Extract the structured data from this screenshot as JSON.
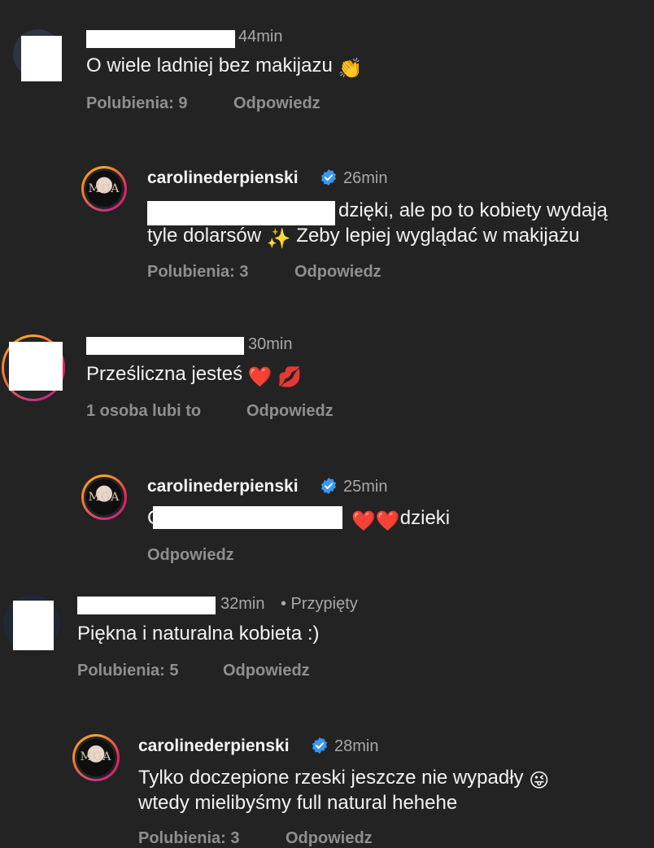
{
  "comments": [
    {
      "time": "44min",
      "text": "O wiele ladniej bez makijazu",
      "emoji": "👏",
      "likes": "Polubienia: 9",
      "reply": "Odpowiedz"
    },
    {
      "username": "carolinederpienski",
      "time": "26min",
      "line1": "dzięki, ale po to kobiety wydają",
      "line2_a": "tyle dolarsów",
      "line2_emoji": "✨",
      "line2_b": "Zeby lepiej wyglądać w makijażu",
      "likes": "Polubienia: 3",
      "reply": "Odpowiedz"
    },
    {
      "time": "30min",
      "text": "Prześliczna jesteś",
      "emoji": "❤️",
      "emoji2": "💋",
      "likes": "1 osoba lubi to",
      "reply": "Odpowiedz"
    },
    {
      "username": "carolinederpienski",
      "time": "25min",
      "text_prefix": "C",
      "emoji": "❤️❤️",
      "text": "dzieki",
      "reply": "Odpowiedz"
    },
    {
      "time": "32min",
      "pinned": "• Przypięty",
      "text": "Piękna i naturalna kobieta :)",
      "likes": "Polubienia: 5",
      "reply": "Odpowiedz"
    },
    {
      "username": "carolinederpienski",
      "time": "28min",
      "line1": "Tylko doczepione rzeski jeszcze nie wypadły",
      "line1_emoji": "😜",
      "line2": "wtedy mielibyśmy full natural hehehe",
      "likes": "Polubienia: 3",
      "reply": "Odpowiedz"
    }
  ],
  "avatar_mark": "MGA",
  "colors": {
    "background": "#232323",
    "verified": "#3897f0",
    "meta": "#8f8f8f"
  },
  "icons": {
    "verified": "verified-badge-icon"
  }
}
